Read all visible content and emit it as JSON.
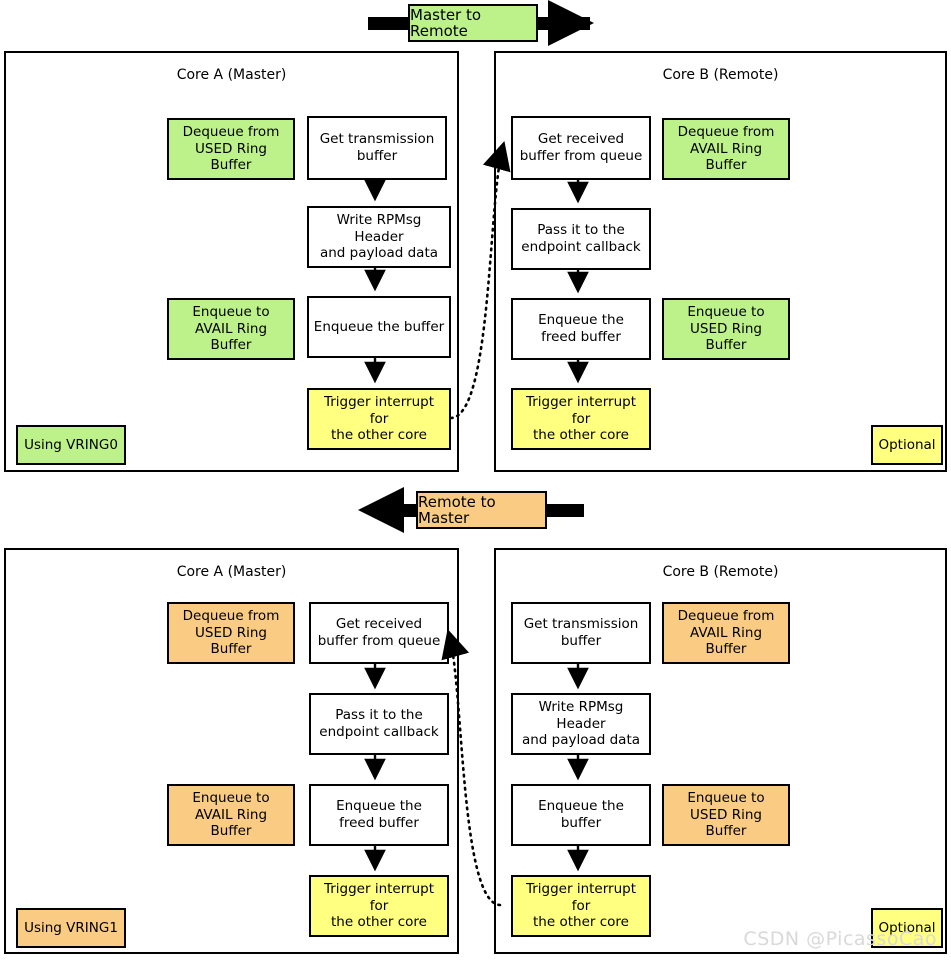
{
  "colors": {
    "green": "#bdf28a",
    "orange": "#f9cb83",
    "yellow": "#ffff80",
    "white": "#ffffff",
    "stroke": "#000000",
    "watermark": "#d9d9d9"
  },
  "bands": [
    {
      "label": "Master to Remote",
      "direction": "right",
      "fill": "#bdf28a",
      "icon": "arrow-right-icon"
    },
    {
      "label": "Remote to Master",
      "direction": "left",
      "fill": "#f9cb83",
      "icon": "arrow-left-icon"
    }
  ],
  "sections": [
    {
      "id": "master-to-remote",
      "panels": [
        {
          "id": "top-core-a",
          "title": "Core A (Master)",
          "ring_nodes": [
            {
              "label": "Dequeue from\nUSED Ring Buffer",
              "fill": "green"
            },
            {
              "label": "Enqueue to\nAVAIL Ring Buffer",
              "fill": "green"
            }
          ],
          "flow_nodes": [
            {
              "label": "Get transmission\nbuffer",
              "fill": "white"
            },
            {
              "label": "Write RPMsg Header\nand payload data",
              "fill": "white"
            },
            {
              "label": "Enqueue the buffer",
              "fill": "white"
            },
            {
              "label": "Trigger interrupt for\nthe other core",
              "fill": "yellow"
            }
          ],
          "badge": {
            "label": "Using VRING0",
            "fill": "green",
            "align": "left"
          }
        },
        {
          "id": "top-core-b",
          "title": "Core B (Remote)",
          "ring_nodes": [
            {
              "label": "Dequeue from\nAVAIL Ring Buffer",
              "fill": "green"
            },
            {
              "label": "Enqueue to\nUSED Ring Buffer",
              "fill": "green"
            }
          ],
          "flow_nodes": [
            {
              "label": "Get received\nbuffer from queue",
              "fill": "white"
            },
            {
              "label": "Pass it to the\nendpoint callback",
              "fill": "white"
            },
            {
              "label": "Enqueue the\nfreed buffer",
              "fill": "white"
            },
            {
              "label": "Trigger interrupt for\nthe other core",
              "fill": "yellow"
            }
          ],
          "badge": {
            "label": "Optional",
            "fill": "yellow",
            "align": "right"
          }
        }
      ]
    },
    {
      "id": "remote-to-master",
      "panels": [
        {
          "id": "bottom-core-a",
          "title": "Core A (Master)",
          "ring_nodes": [
            {
              "label": "Dequeue from\nUSED Ring Buffer",
              "fill": "orange"
            },
            {
              "label": "Enqueue to\nAVAIL Ring Buffer",
              "fill": "orange"
            }
          ],
          "flow_nodes": [
            {
              "label": "Get received\nbuffer from queue",
              "fill": "white"
            },
            {
              "label": "Pass it to the\nendpoint callback",
              "fill": "white"
            },
            {
              "label": "Enqueue the\nfreed buffer",
              "fill": "white"
            },
            {
              "label": "Trigger interrupt for\nthe other core",
              "fill": "yellow"
            }
          ],
          "badge": {
            "label": "Using VRING1",
            "fill": "orange",
            "align": "left"
          }
        },
        {
          "id": "bottom-core-b",
          "title": "Core B (Remote)",
          "ring_nodes": [
            {
              "label": "Dequeue from\nAVAIL Ring Buffer",
              "fill": "orange"
            },
            {
              "label": "Enqueue to\nUSED Ring Buffer",
              "fill": "orange"
            }
          ],
          "flow_nodes": [
            {
              "label": "Get transmission\nbuffer",
              "fill": "white"
            },
            {
              "label": "Write RPMsg Header\nand payload data",
              "fill": "white"
            },
            {
              "label": "Enqueue the buffer",
              "fill": "white"
            },
            {
              "label": "Trigger interrupt for\nthe other core",
              "fill": "yellow"
            }
          ],
          "badge": {
            "label": "Optional",
            "fill": "yellow",
            "align": "right"
          }
        }
      ]
    }
  ],
  "watermark": "CSDN @PicassoCao"
}
